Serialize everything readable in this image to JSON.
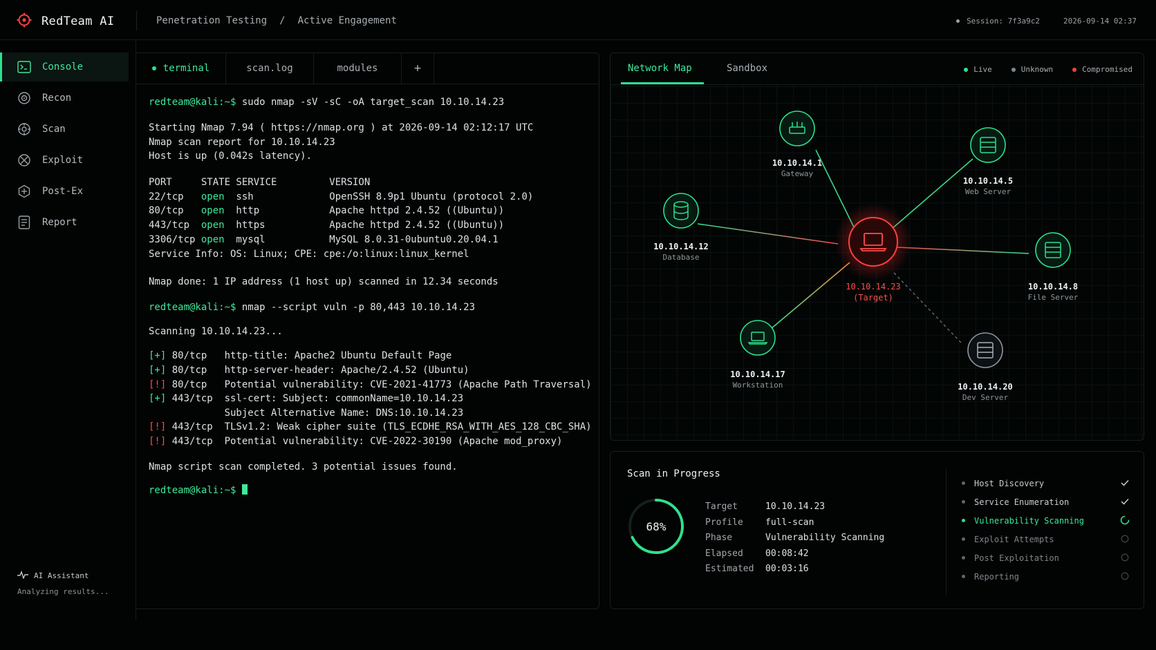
{
  "app": {
    "name": "RedTeam AI"
  },
  "breadcrumb": [
    "Penetration Testing",
    "/",
    "Active Engagement"
  ],
  "header": {
    "session": "Session: 7f3a9c2",
    "datetime": "2026-09-14 02:37"
  },
  "sidebar": {
    "items": [
      {
        "label": "Console",
        "icon": "console-icon",
        "active": true
      },
      {
        "label": "Recon",
        "icon": "recon-icon"
      },
      {
        "label": "Scan",
        "icon": "scan-icon"
      },
      {
        "label": "Exploit",
        "icon": "exploit-icon"
      },
      {
        "label": "Post-Ex",
        "icon": "post-ex-icon"
      },
      {
        "label": "Report",
        "icon": "report-icon"
      }
    ],
    "assistant_label": "AI Assistant",
    "assistant_status": "Analyzing results..."
  },
  "terminal": {
    "tabs": [
      "terminal",
      "scan.log",
      "modules",
      "+"
    ],
    "prompt": "redteam@kali:~$",
    "lines": [
      {
        "prompt": "redteam@kali:~$",
        "text": " sudo nmap -sV -sC -oA target_scan 10.10.14.23"
      },
      {
        "text": "Starting Nmap 7.94 ( https://nmap.org ) at 2026-09-14 02:12:17 UTC"
      },
      {
        "text": "Nmap scan report for 10.10.14.23"
      },
      {
        "text": "Host is up (0.042s latency)."
      },
      {
        "text": "PORT     STATE SERVICE         VERSION"
      },
      {
        "a": "22/tcp   ",
        "g": "open",
        "b": "  ssh             OpenSSH 8.9p1 Ubuntu (protocol 2.0)"
      },
      {
        "a": "80/tcp   ",
        "g": "open",
        "b": "  http            Apache httpd 2.4.52 ((Ubuntu))"
      },
      {
        "a": "443/tcp  ",
        "g": "open",
        "b": "  https           Apache httpd 2.4.52 ((Ubuntu))"
      },
      {
        "a": "3306/tcp ",
        "g": "open",
        "b": "  mysql           MySQL 8.0.31-0ubuntu0.20.04.1"
      },
      {
        "text": "Service Info: OS: Linux; CPE: cpe:/o:linux:linux_kernel"
      },
      {
        "text": "Nmap done: 1 IP address (1 host up) scanned in 12.34 seconds"
      },
      {
        "prompt": "redteam@kali:~$",
        "text": " nmap --script vuln -p 80,443 10.10.14.23"
      },
      {
        "text": "Scanning 10.10.14.23..."
      },
      {
        "mark": "[+]",
        "kind": "ok",
        "text": " 80/tcp   http-title: Apache2 Ubuntu Default Page"
      },
      {
        "mark": "[+]",
        "kind": "ok",
        "text": " 80/tcp   http-server-header: Apache/2.4.52 (Ubuntu)"
      },
      {
        "mark": "[!]",
        "kind": "warn",
        "text": " 80/tcp   Potential vulnerability: CVE-2021-41773 (Apache Path Traversal)"
      },
      {
        "mark": "[+]",
        "kind": "ok",
        "text": " 443/tcp  ssl-cert: Subject: commonName=10.10.14.23"
      },
      {
        "text": "             Subject Alternative Name: DNS:10.10.14.23"
      },
      {
        "mark": "[!]",
        "kind": "warn",
        "text": " 443/tcp  TLSv1.2: Weak cipher suite (TLS_ECDHE_RSA_WITH_AES_128_CBC_SHA)"
      },
      {
        "mark": "[!]",
        "kind": "warn",
        "text": " 443/tcp  Potential vulnerability: CVE-2022-30190 (Apache mod_proxy)"
      },
      {
        "text": "Nmap script scan completed. 3 potential issues found."
      },
      {
        "prompt": "redteam@kali:~$",
        "text": " ",
        "cursor": true
      }
    ]
  },
  "map": {
    "tabs": [
      "Network Map",
      "Sandbox"
    ],
    "legend": [
      {
        "label": "Live",
        "color": "#2fe08c"
      },
      {
        "label": "Unknown",
        "color": "#7c8a93"
      },
      {
        "label": "Compromised",
        "color": "#ff4040"
      }
    ],
    "nodes": [
      {
        "id": "gateway",
        "ip": "10.10.14.1",
        "role": "Gateway",
        "icon": "router-icon",
        "status": "live"
      },
      {
        "id": "webserver",
        "ip": "10.10.14.5",
        "role": "Web Server",
        "icon": "server-icon",
        "status": "live"
      },
      {
        "id": "database",
        "ip": "10.10.14.12",
        "role": "Database",
        "icon": "database-icon",
        "status": "live"
      },
      {
        "id": "target",
        "ip": "10.10.14.23",
        "role": "(Target)",
        "icon": "laptop-icon",
        "status": "compromised"
      },
      {
        "id": "fileserver",
        "ip": "10.10.14.8",
        "role": "File Server",
        "icon": "server-icon",
        "status": "live"
      },
      {
        "id": "workstation",
        "ip": "10.10.14.17",
        "role": "Workstation",
        "icon": "laptop-icon",
        "status": "live"
      },
      {
        "id": "devserver",
        "ip": "10.10.14.20",
        "role": "Dev Server",
        "icon": "server-icon",
        "status": "unknown"
      }
    ]
  },
  "scan": {
    "title": "Scan in Progress",
    "progress": 68,
    "progress_label": "68%",
    "details": [
      {
        "key": "Target",
        "value": "10.10.14.23"
      },
      {
        "key": "Profile",
        "value": "full-scan"
      },
      {
        "key": "Phase",
        "value": "Vulnerability Scanning"
      },
      {
        "key": "Elapsed",
        "value": "00:08:42"
      },
      {
        "key": "Estimated",
        "value": "00:03:16"
      }
    ],
    "steps": [
      {
        "label": "Host Discovery",
        "state": "done"
      },
      {
        "label": "Service Enumeration",
        "state": "done"
      },
      {
        "label": "Vulnerability Scanning",
        "state": "active"
      },
      {
        "label": "Exploit Attempts",
        "state": "pending"
      },
      {
        "label": "Post Exploitation",
        "state": "pending"
      },
      {
        "label": "Reporting",
        "state": "pending"
      }
    ]
  }
}
